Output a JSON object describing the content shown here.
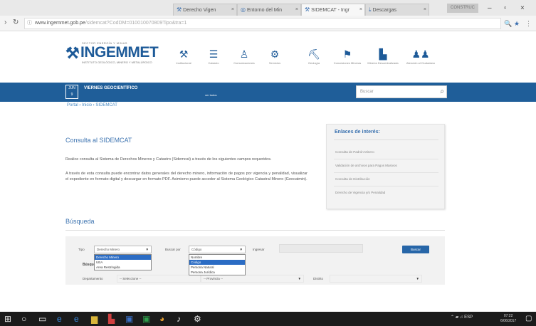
{
  "browser": {
    "tabs": [
      {
        "title": "Derecho Vigen",
        "active": false
      },
      {
        "title": "Entorno del Min",
        "active": false
      },
      {
        "title": "SIDEMCAT - Ingr",
        "active": true
      },
      {
        "title": "Descargas",
        "active": false
      }
    ],
    "profile": "CONSTRUC",
    "url_host": "www.ingemmet.gob.pe",
    "url_path": "/sidemcat?CodDM=010010070809Tipo&tra=1"
  },
  "header": {
    "logo_top": "SECTOR ENERGÍA Y MINAS",
    "logo": "INGEMMET",
    "logo_sub": "INSTITUTO GEOLÓGICO, MINERO Y METALÚRGICO",
    "nav": [
      {
        "label": "Institucional",
        "icon": "tools-icon"
      },
      {
        "label": "Catastro",
        "icon": "database-icon"
      },
      {
        "label": "Comunicaciones",
        "icon": "comms-icon"
      },
      {
        "label": "Servicios",
        "icon": "services-icon"
      },
      {
        "label": "Geología",
        "icon": "geology-icon"
      },
      {
        "label": "Concesiones Mineras",
        "icon": "concessions-icon"
      },
      {
        "label": "Minería Descentralizada",
        "icon": "mining-icon"
      },
      {
        "label": "Atención al Ciudadano",
        "icon": "citizens-icon"
      }
    ]
  },
  "bluebar": {
    "date_top": "JUN",
    "date_day": "9",
    "title": "VIERNES GEOCIENTÍFICO",
    "ver_todos": "ver todos",
    "search_placeholder": "Buscar"
  },
  "breadcrumb": "Portal › Inicio › SIDEMCAT",
  "main": {
    "title": "Consulta al SIDEMCAT",
    "p1": "Realice consulta al Sistema de Derechos Mineros y Catastro (Sidemcat) a través de los siguientes campos requeridos.",
    "p2": "A través de esta consulta puede encontrar datos generales del derecho minero, información de pagos por vigencia y penalidad, visualizar el expediente en formato digital y descargar en formato PDF. Asimismo puede acceder al Sistema Geológico Catastral Minero (Geocatmin)."
  },
  "links": {
    "title": "Enlaces de interés:",
    "items": [
      "Consulta de Padrón Minero",
      "Validación de archivos para Pagos Masivos",
      "Consulta de Distribución",
      "Derecho de Vigencia y/o Penalidad"
    ]
  },
  "busqueda": {
    "title": "Búsqueda",
    "tipo_label": "Tipo",
    "tipo_value": "Derecho Minero",
    "tipo_options": [
      "Derecho Minero",
      "UEA",
      "Area Restringida"
    ],
    "buscar_por_label": "Buscar por",
    "buscar_por_value": "Código",
    "buscar_por_options": [
      "Nombre",
      "Código",
      "Persona Natural",
      "Persona Jurídica"
    ],
    "ingresar_label": "Ingresar",
    "buscar_button": "Buscar",
    "sub_label": "Búsque",
    "departamento_label": "Departamento",
    "departamento_value": "-- Seleccione --",
    "provincia_value": "-- Provincia --",
    "distrito_label": "Distrito"
  },
  "taskbar": {
    "tray": "ESP",
    "time": "07:22",
    "date": "6/06/2017"
  }
}
